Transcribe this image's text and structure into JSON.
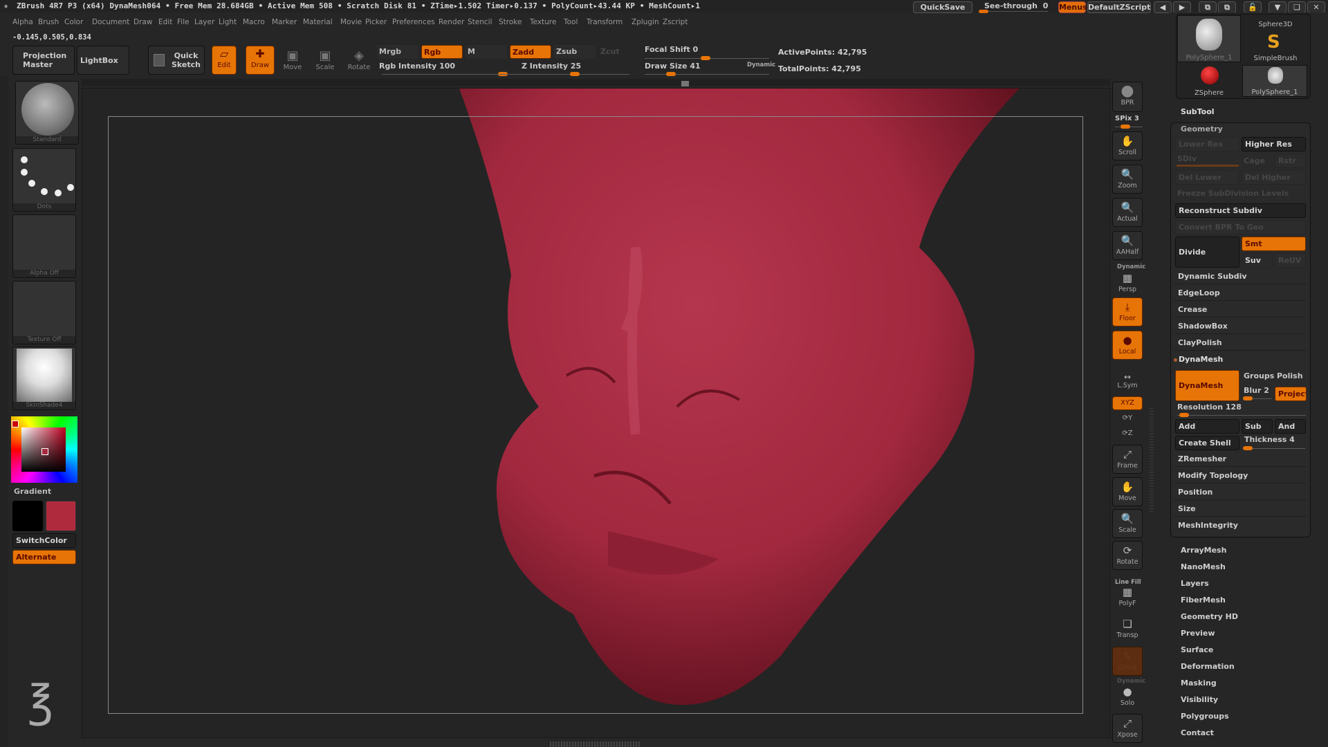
{
  "titlebar": {
    "app_title": "ZBrush 4R7 P3 (x64)   DynaMesh064   • Free Mem 28.684GB • Active Mem 508 • Scratch Disk 81 •  ZTime▸1.502 Timer▸0.137 • PolyCount▸43.44 KP  • MeshCount▸1",
    "quicksave": "QuickSave",
    "see_through_label": "See-through",
    "see_through_value": "0",
    "menus": "Menus",
    "default_zscript": "DefaultZScript",
    "window_controls": [
      "scroll-left",
      "scroll-right",
      "layout-prev",
      "layout-next",
      "unlock",
      "minimize",
      "restore",
      "close"
    ]
  },
  "menubar": [
    "Alpha",
    "Brush",
    "Color",
    "Document",
    "Draw",
    "Edit",
    "File",
    "Layer",
    "Light",
    "Macro",
    "Marker",
    "Material",
    "Movie",
    "Picker",
    "Preferences",
    "Render",
    "Stencil",
    "Stroke",
    "Texture",
    "Tool",
    "Transform",
    "Zplugin",
    "Zscript"
  ],
  "coords": "-0.145,0.505,0.834",
  "toolbar": {
    "projection_master": "Projection Master",
    "lightbox": "LightBox",
    "quick_sketch": "Quick Sketch",
    "edit": "Edit",
    "draw": "Draw",
    "move": "Move",
    "scale": "Scale",
    "rotate": "Rotate",
    "mrgb": "Mrgb",
    "rgb": "Rgb",
    "m": "M",
    "zadd": "Zadd",
    "zsub": "Zsub",
    "zcut": "Zcut",
    "rgb_intensity_label": "Rgb Intensity 100",
    "rgb_intensity": 100,
    "z_intensity_label": "Z Intensity 25",
    "z_intensity": 25,
    "focal_shift_label": "Focal Shift 0",
    "focal_shift": 0,
    "draw_size_label": "Draw Size 41",
    "draw_size": 41,
    "dynamic": "Dynamic",
    "active_points": "ActivePoints: 42,795",
    "total_points": "TotalPoints: 42,795"
  },
  "left_shelf": {
    "brush": "Standard",
    "stroke": "Dots",
    "alpha": "Alpha Off",
    "texture": "Texture Off",
    "material": "SkinShade4",
    "gradient": "Gradient",
    "switch_color": "SwitchColor",
    "alternate": "Alternate",
    "colors": {
      "primary": "#b02a3e",
      "secondary": "#000000"
    }
  },
  "right_shelf": {
    "bpr": "BPR",
    "spix": "SPix 3",
    "buttons": [
      "Scroll",
      "Zoom",
      "Actual",
      "AAHalf",
      "Persp",
      "Floor",
      "Local",
      "L.Sym",
      "XYZ",
      "Y",
      "Z",
      "Frame",
      "Move",
      "Scale",
      "Rotate",
      "PolyF",
      "Transp",
      "Ghost",
      "Solo",
      "Xpose"
    ],
    "dynamic_label": "Dynamic",
    "line_fill": "Line Fill"
  },
  "lightbox_tools": [
    "PolySphere_1",
    "Sphere3D",
    "SimpleBrush",
    "ZSphere",
    "PolySphere_1"
  ],
  "tool_panel": {
    "subtool": "SubTool",
    "geometry": "Geometry",
    "lower_res": "Lower Res",
    "higher_res": "Higher Res",
    "sdiv": "SDiv",
    "cage": "Cage",
    "rstr": "Rstr",
    "del_lower": "Del Lower",
    "del_higher": "Del Higher",
    "freeze": "Freeze SubDivision Levels",
    "reconstruct": "Reconstruct Subdiv",
    "convert_bpr": "Convert BPR To Geo",
    "divide": "Divide",
    "smt": "Smt",
    "suv": "Suv",
    "reuv": "ReUV",
    "sections": [
      "Dynamic Subdiv",
      "EdgeLoop",
      "Crease",
      "ShadowBox",
      "ClayPolish"
    ],
    "dynamesh_header": "DynaMesh",
    "dynamesh_btn": "DynaMesh",
    "groups": "Groups",
    "polish": "Polish",
    "blur_label": "Blur 2",
    "project": "Project",
    "resolution_label": "Resolution 128",
    "resolution": 128,
    "add": "Add",
    "sub": "Sub",
    "and": "And",
    "create_shell": "Create Shell",
    "thickness_label": "Thickness 4",
    "more_sections": [
      "ZRemesher",
      "Modify Topology",
      "Position",
      "Size",
      "MeshIntegrity"
    ],
    "subpalettes": [
      "ArrayMesh",
      "NanoMesh",
      "Layers",
      "FiberMesh",
      "Geometry HD",
      "Preview",
      "Surface",
      "Deformation",
      "Masking",
      "Visibility",
      "Polygroups",
      "Contact"
    ]
  },
  "canvas": {
    "mesh_color": "#a52a40"
  }
}
